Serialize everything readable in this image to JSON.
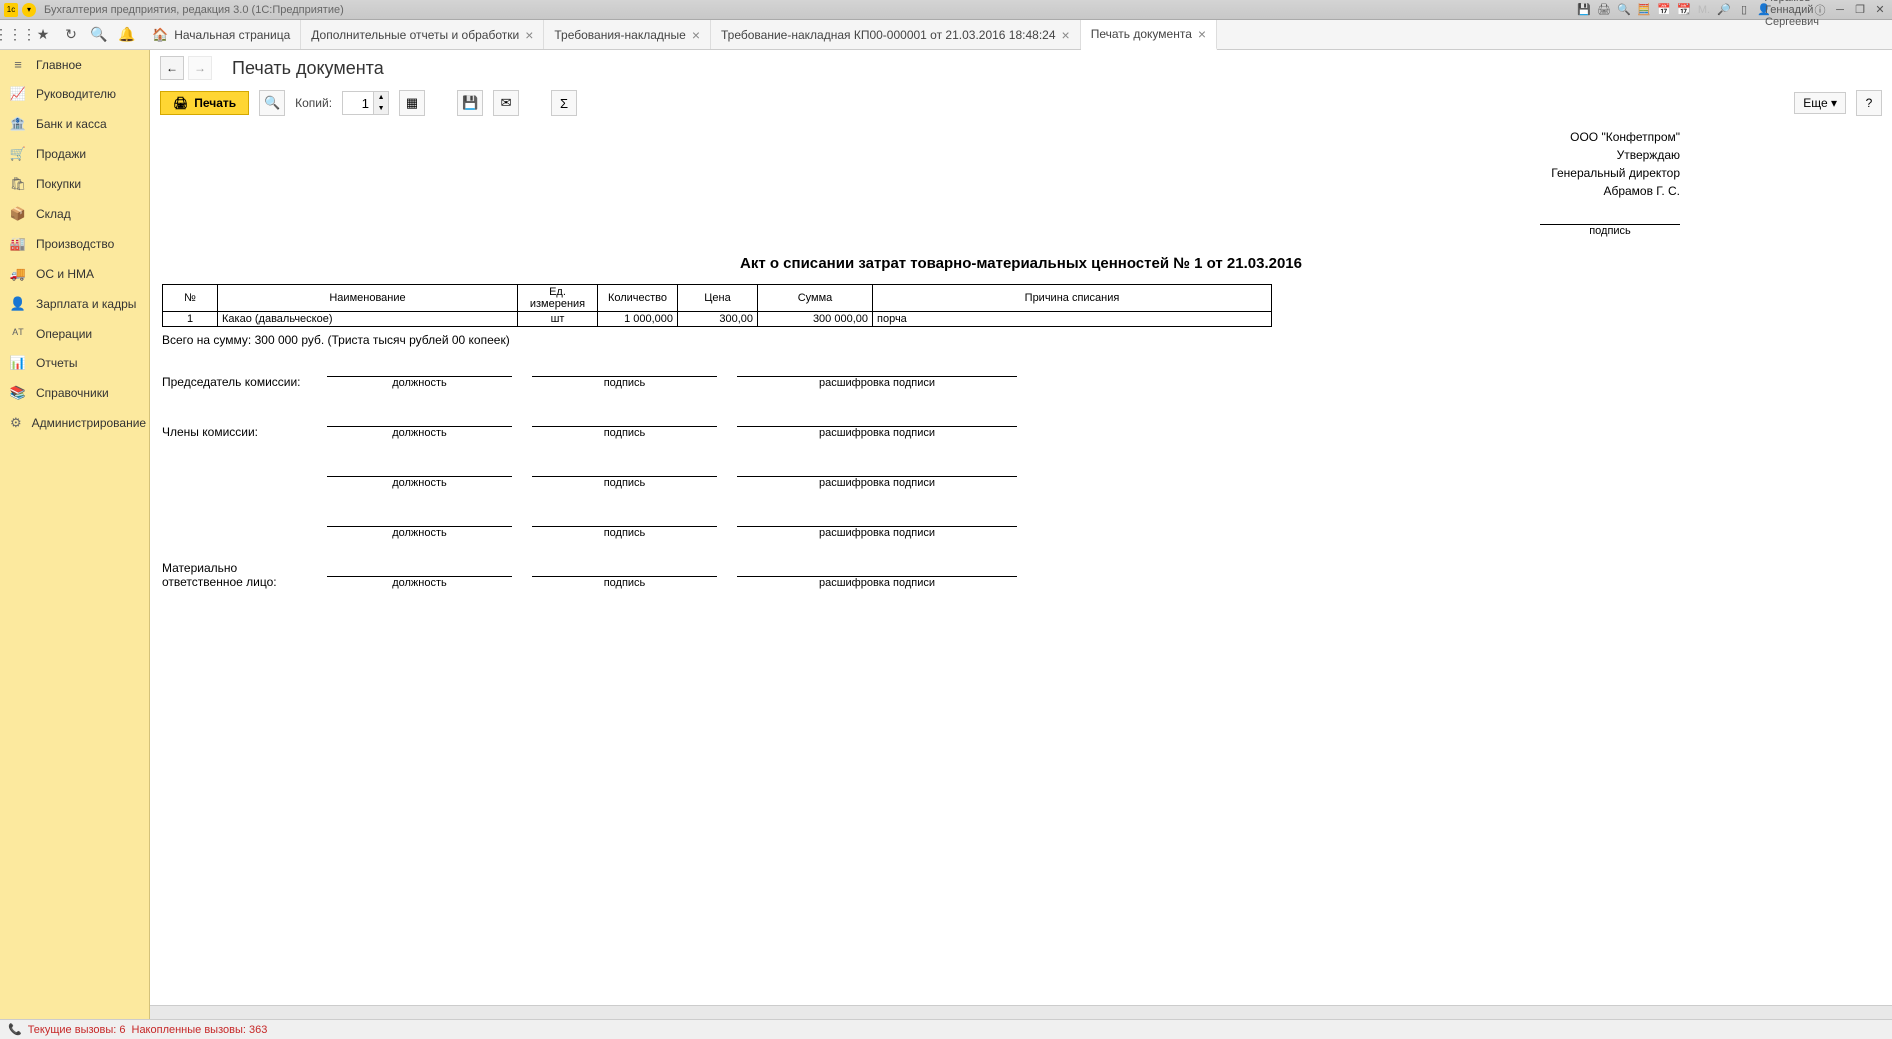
{
  "titlebar": {
    "app_title": "Бухгалтерия предприятия, редакция 3.0  (1С:Предприятие)",
    "user": "Абрамов Геннадий Сергеевич"
  },
  "tabs": [
    {
      "label": "Начальная страница",
      "home": true,
      "closable": false
    },
    {
      "label": "Дополнительные отчеты и обработки",
      "closable": true
    },
    {
      "label": "Требования-накладные",
      "closable": true
    },
    {
      "label": "Требование-накладная КП00-000001 от 21.03.2016 18:48:24",
      "closable": true
    },
    {
      "label": "Печать документа",
      "closable": true,
      "active": true
    }
  ],
  "sidebar": [
    {
      "icon": "≡",
      "label": "Главное"
    },
    {
      "icon": "📈",
      "label": "Руководителю"
    },
    {
      "icon": "🏦",
      "label": "Банк и касса"
    },
    {
      "icon": "🛒",
      "label": "Продажи"
    },
    {
      "icon": "🛍",
      "label": "Покупки"
    },
    {
      "icon": "📦",
      "label": "Склад"
    },
    {
      "icon": "🏭",
      "label": "Производство"
    },
    {
      "icon": "🚚",
      "label": "ОС и НМА"
    },
    {
      "icon": "👤",
      "label": "Зарплата и кадры"
    },
    {
      "icon": "ᴬᵀ",
      "label": "Операции"
    },
    {
      "icon": "📊",
      "label": "Отчеты"
    },
    {
      "icon": "📚",
      "label": "Справочники"
    },
    {
      "icon": "⚙",
      "label": "Администрирование"
    }
  ],
  "page": {
    "title": "Печать документа",
    "print_btn": "Печать",
    "copies_label": "Копий:",
    "copies_value": "1",
    "more_btn": "Еще",
    "help_btn": "?"
  },
  "document": {
    "org": "ООО \"Конфетпром\"",
    "approve": "Утверждаю",
    "director": "Генеральный директор",
    "director_name": "Абрамов Г. С.",
    "sign_caption": "подпись",
    "title": "Акт о списании затрат товарно-материальных ценностей № 1 от 21.03.2016",
    "headers": {
      "num": "№",
      "name": "Наименование",
      "unit": "Ед. измерения",
      "qty": "Количество",
      "price": "Цена",
      "sum": "Сумма",
      "reason": "Причина списания"
    },
    "rows": [
      {
        "num": "1",
        "name": "Какао (давальческое)",
        "unit": "шт",
        "qty": "1 000,000",
        "price": "300,00",
        "sum": "300 000,00",
        "reason": "порча"
      }
    ],
    "total": "Всего на сумму: 300 000 руб. (Триста тысяч рублей 00 копеек)",
    "chairman": "Председатель комиссии:",
    "members": "Члены комиссии:",
    "responsible": "Материально ответственное лицо:",
    "cap_position": "должность",
    "cap_sign": "подпись",
    "cap_decipher": "расшифровка подписи"
  },
  "statusbar": {
    "current": "Текущие вызовы: 6",
    "accumulated": "Накопленные вызовы: 363"
  }
}
